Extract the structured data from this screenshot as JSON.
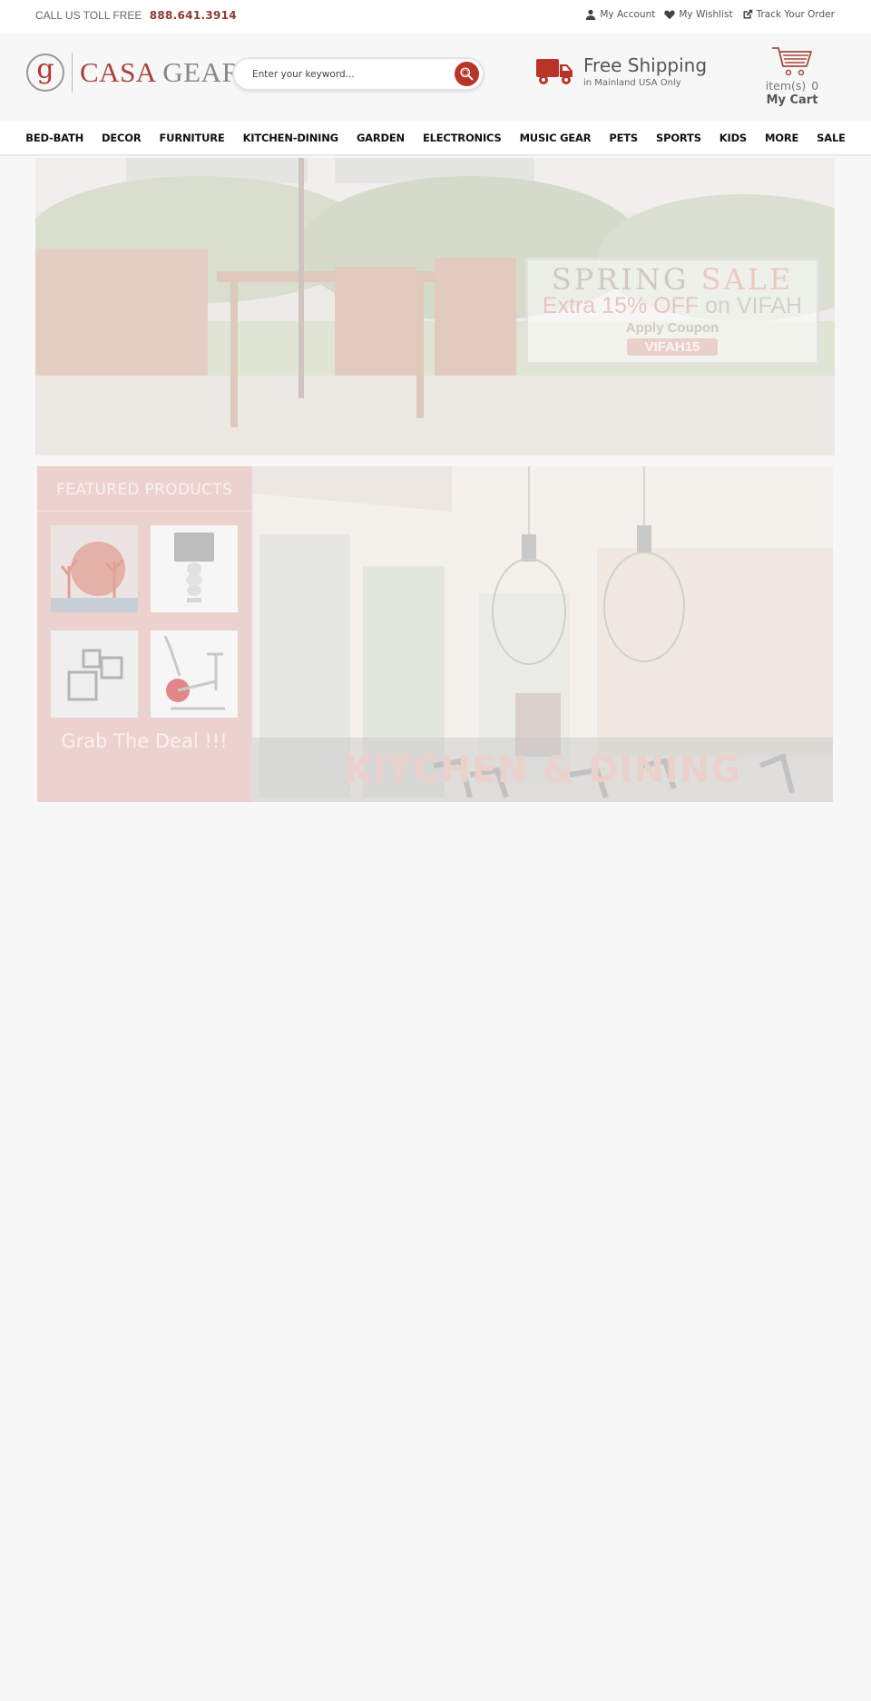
{
  "topbar": {
    "call_label": "CALL US TOLL FREE",
    "phone": "888.641.3914",
    "links": [
      {
        "label": "My Account",
        "icon": "user-icon"
      },
      {
        "label": "My Wishlist",
        "icon": "heart-icon"
      },
      {
        "label": "Track Your Order",
        "icon": "external-link-icon"
      }
    ]
  },
  "header": {
    "logo": {
      "mark": "g",
      "brand_primary": "CASA",
      "brand_secondary": "GEAR"
    },
    "search": {
      "placeholder": "Enter your keyword...",
      "value": ""
    },
    "shipping": {
      "title": "Free Shipping",
      "subtitle": "in Mainland USA Only"
    },
    "cart": {
      "items_label": "item(s)",
      "count": "0",
      "label": "My Cart"
    }
  },
  "nav": {
    "items": [
      "BED-BATH",
      "DECOR",
      "FURNITURE",
      "KITCHEN-DINING",
      "GARDEN",
      "ELECTRONICS",
      "MUSIC GEAR",
      "PETS",
      "SPORTS",
      "KIDS",
      "MORE",
      "SALE"
    ]
  },
  "banner": {
    "headline_part1": "SPRING ",
    "headline_part2": "SALE",
    "offer": "Extra 15% OFF",
    "offer_suffix": " on VIFAH",
    "apply_label": "Apply Coupon",
    "coupon_code": "VIFAH15"
  },
  "featured": {
    "title": "FEATURED PRODUCTS",
    "products": [
      {
        "name": "coral-decor"
      },
      {
        "name": "table-lamp"
      },
      {
        "name": "wall-frames"
      },
      {
        "name": "exercise-bike"
      }
    ],
    "cta": "Grab The Deal !!!"
  },
  "category_banner": {
    "caption": "KITCHEN & DINING"
  },
  "colors": {
    "brand": "#b93428",
    "phone": "#8e3a33",
    "featured_bg": "#ebd2cf",
    "page_bg": "#f7f7f7"
  }
}
